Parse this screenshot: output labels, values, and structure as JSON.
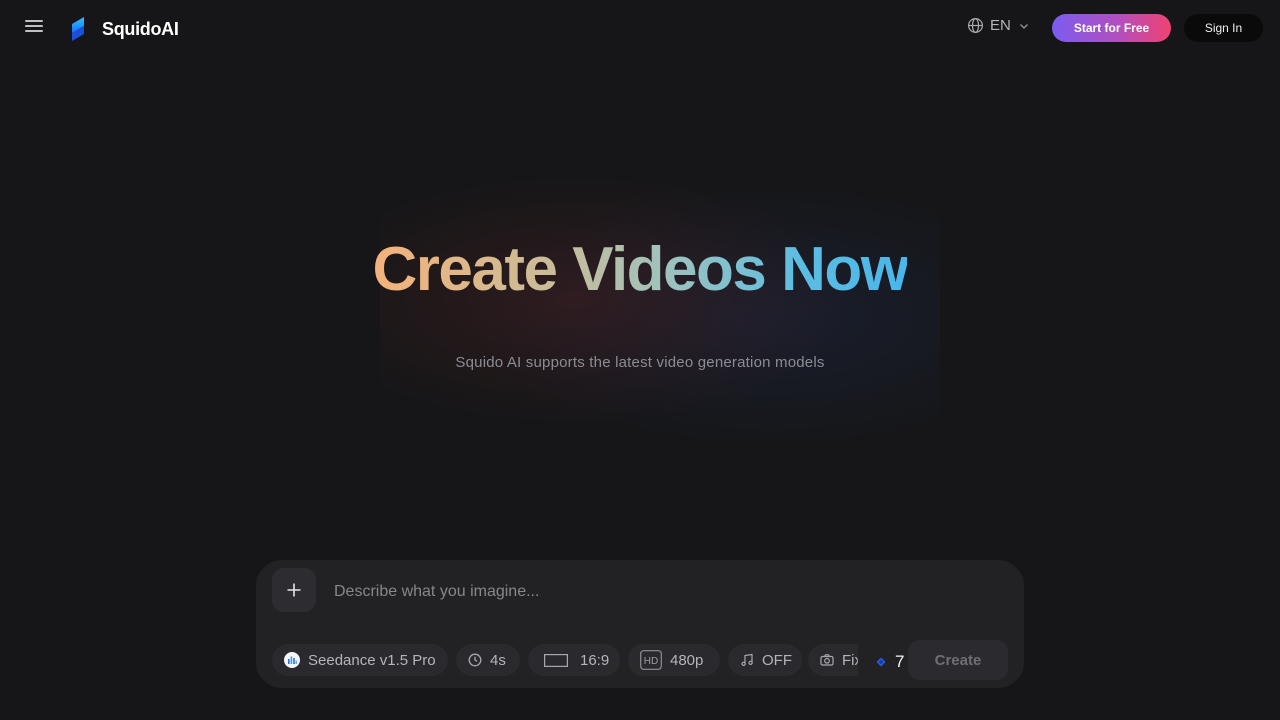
{
  "header": {
    "brand": "SquidoAI",
    "language": "EN",
    "start_label": "Start for Free",
    "signin_label": "Sign In"
  },
  "hero": {
    "title": "Create Videos Now",
    "subtitle": "Squido AI supports the latest video generation models"
  },
  "composer": {
    "placeholder": "Describe what you imagine...",
    "chips": {
      "model": "Seedance v1.5 Pro",
      "duration": "4s",
      "aspect": "16:9",
      "resolution": "480p",
      "audio": "OFF",
      "camera": "Fixed"
    },
    "credits": "7",
    "create_label": "Create"
  },
  "colors": {
    "background": "#161618",
    "start_gradient_from": "#7b5cf0",
    "start_gradient_to": "#f0426f",
    "title_gradient_from": "#f4b27a",
    "title_gradient_to": "#49b6ea"
  },
  "icons": {
    "menu": "hamburger-icon",
    "language": "globe-icon",
    "dropdown": "chevron-down-icon",
    "add": "plus-icon",
    "duration": "clock-icon",
    "aspect": "aspect-ratio-icon",
    "resolution": "hd-icon",
    "audio": "music-note-icon",
    "camera": "camera-icon",
    "credits": "gem-icon"
  }
}
